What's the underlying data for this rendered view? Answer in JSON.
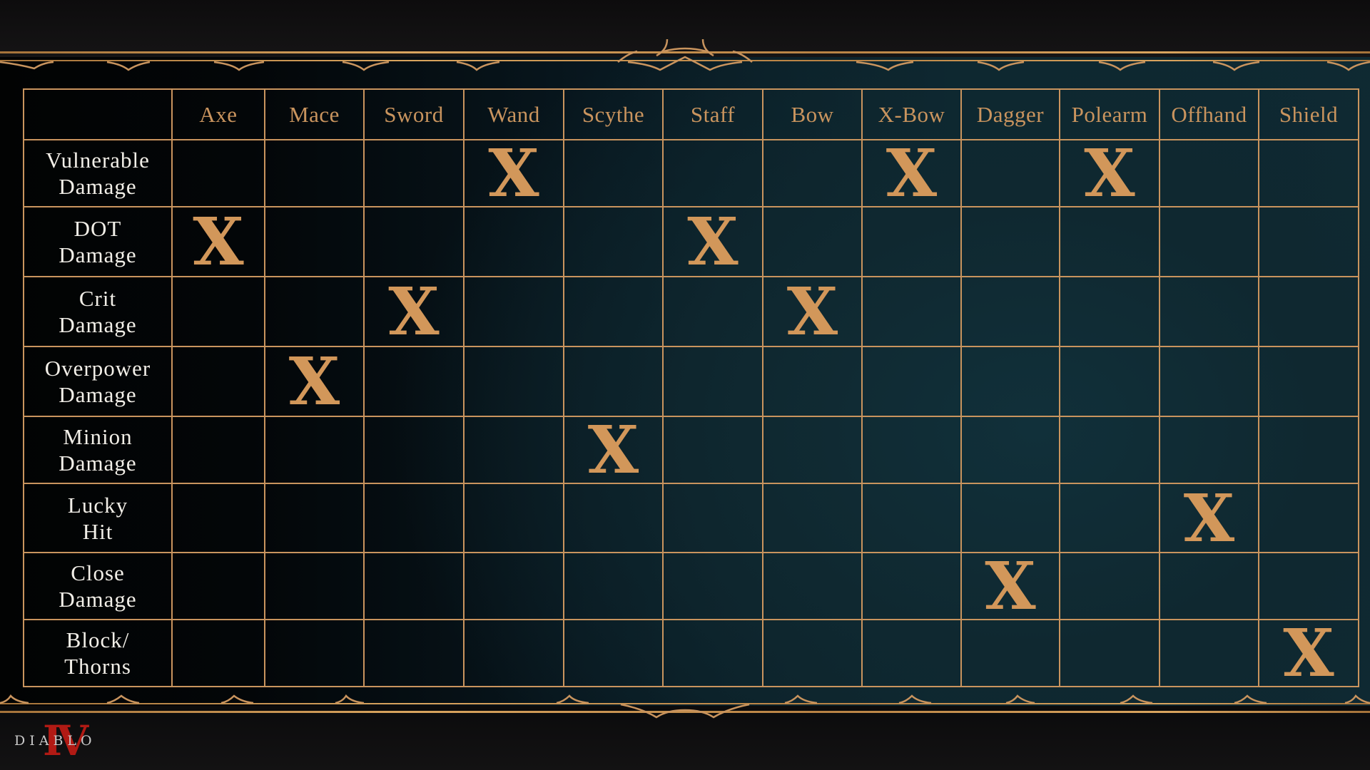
{
  "table": {
    "columns": [
      "Axe",
      "Mace",
      "Sword",
      "Wand",
      "Scythe",
      "Staff",
      "Bow",
      "X-Bow",
      "Dagger",
      "Polearm",
      "Offhand",
      "Shield"
    ],
    "rows": [
      {
        "label_line1": "Vulnerable",
        "label_line2": "Damage",
        "marks": [
          "",
          "",
          "",
          "X",
          "",
          "",
          "",
          "X",
          "",
          "X",
          "",
          ""
        ]
      },
      {
        "label_line1": "DOT",
        "label_line2": "Damage",
        "marks": [
          "X",
          "",
          "",
          "",
          "",
          "X",
          "",
          "",
          "",
          "",
          "",
          ""
        ]
      },
      {
        "label_line1": "Crit",
        "label_line2": "Damage",
        "marks": [
          "",
          "",
          "X",
          "",
          "",
          "",
          "X",
          "",
          "",
          "",
          "",
          ""
        ]
      },
      {
        "label_line1": "Overpower",
        "label_line2": "Damage",
        "marks": [
          "",
          "X",
          "",
          "",
          "",
          "",
          "",
          "",
          "",
          "",
          "",
          ""
        ]
      },
      {
        "label_line1": "Minion",
        "label_line2": "Damage",
        "marks": [
          "",
          "",
          "",
          "",
          "X",
          "",
          "",
          "",
          "",
          "",
          "",
          ""
        ]
      },
      {
        "label_line1": "Lucky",
        "label_line2": "Hit",
        "marks": [
          "",
          "",
          "",
          "",
          "",
          "",
          "",
          "",
          "",
          "",
          "X",
          ""
        ]
      },
      {
        "label_line1": "Close",
        "label_line2": "Damage",
        "marks": [
          "",
          "",
          "",
          "",
          "",
          "",
          "",
          "",
          "X",
          "",
          "",
          ""
        ]
      },
      {
        "label_line1": "Block/",
        "label_line2": "Thorns",
        "marks": [
          "",
          "",
          "",
          "",
          "",
          "",
          "",
          "",
          "",
          "",
          "",
          "X"
        ]
      }
    ]
  },
  "logo": {
    "text": "DIABLO",
    "numeral": "IV"
  },
  "colors": {
    "gold": "#c9945e",
    "label_white": "#f2efe8",
    "panel_teal": "#0f2a33",
    "logo_red": "#b11a14"
  }
}
